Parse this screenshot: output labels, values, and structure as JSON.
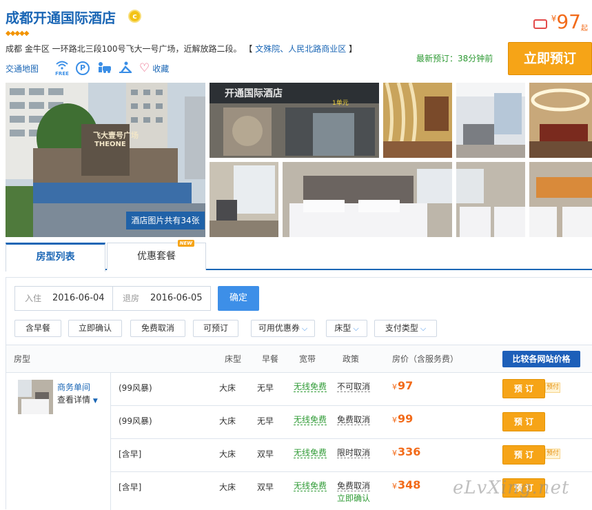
{
  "hotel": {
    "name": "成都开通国际酒店",
    "rating_diamonds": 5,
    "address": "成都 金牛区 一环路北三段100号飞大一号广场，近解放路二段。",
    "area_links": "文殊院、人民北路商业区",
    "map_link": "交通地图",
    "wifi_free_label": "FREE",
    "parking_icon_label": "P",
    "favorite_label": "收藏",
    "photo_count_label": "酒店图片共有34张",
    "price_currency": "¥",
    "price_from": "97",
    "price_suffix": "起",
    "latest_booking": "最新预订：38分钟前",
    "book_now": "立即预订",
    "medal_text": "c",
    "diamonds_text": "◆◆◆◆◆"
  },
  "photos": {
    "main_sign": "THEONE",
    "main_sign_cn": "飞大壹号广场",
    "entrance_sign": "开通国际酒店",
    "entrance_unit": "1单元"
  },
  "tabs": [
    {
      "label": "房型列表",
      "active": true
    },
    {
      "label": "优惠套餐",
      "badge": "NEW"
    }
  ],
  "booking_form": {
    "checkin_label": "入住",
    "checkin": "2016-06-04",
    "checkout_label": "退房",
    "checkout": "2016-06-05",
    "confirm": "确定"
  },
  "filters": [
    {
      "label": "含早餐"
    },
    {
      "label": "立即确认"
    },
    {
      "label": "免费取消"
    },
    {
      "label": "可预订"
    },
    {
      "label": "可用优惠券",
      "dropdown": true
    },
    {
      "label": "床型",
      "dropdown": true
    },
    {
      "label": "支付类型",
      "dropdown": true
    }
  ],
  "table": {
    "headers": {
      "room": "房型",
      "bed": "床型",
      "breakfast": "早餐",
      "broadband": "宽带",
      "policy": "政策",
      "price": "房价（含服务费）"
    },
    "compare_button": "比较各网站价格",
    "room_name": "商务单间",
    "room_details": "查看详情",
    "rows": [
      {
        "plan": "(99风暴)",
        "bed": "大床",
        "breakfast": "无早",
        "broadband": "无线免费",
        "policy": "不可取消",
        "sub_policy": "",
        "currency": "¥",
        "price": "97",
        "book": "预 订",
        "tag": "预付"
      },
      {
        "plan": "(99风暴)",
        "bed": "大床",
        "breakfast": "无早",
        "broadband": "无线免费",
        "policy": "免费取消",
        "sub_policy": "",
        "currency": "¥",
        "price": "99",
        "book": "预 订",
        "tag": ""
      },
      {
        "plan": "[含早]",
        "bed": "大床",
        "breakfast": "双早",
        "broadband": "无线免费",
        "policy": "限时取消",
        "sub_policy": "",
        "currency": "¥",
        "price": "336",
        "book": "预 订",
        "tag": "预付"
      },
      {
        "plan": "[含早]",
        "bed": "大床",
        "breakfast": "双早",
        "broadband": "无线免费",
        "policy": "免费取消",
        "sub_policy": "立即确认",
        "currency": "¥",
        "price": "348",
        "book": "预 订",
        "tag": ""
      }
    ]
  },
  "watermark": "eLvXing.net",
  "colors": {
    "brand_blue": "#1a66b5",
    "accent_orange": "#f6a417",
    "price_orange": "#f26b1a",
    "green": "#2e9a34",
    "button_blue": "#3d8fe8"
  }
}
